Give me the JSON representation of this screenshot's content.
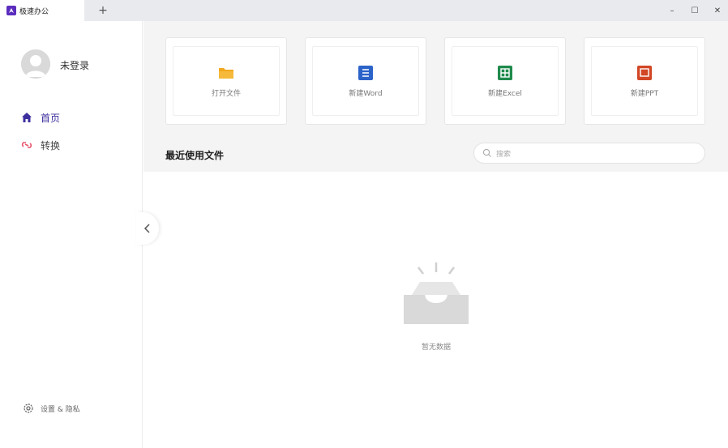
{
  "window": {
    "tab_title": "极速办公",
    "new_tab": "+",
    "minimize": "–",
    "maximize": "☐",
    "close": "✕"
  },
  "sidebar": {
    "username": "未登录",
    "nav": [
      {
        "label": "首页",
        "icon": "home-icon",
        "active": true
      },
      {
        "label": "转换",
        "icon": "convert-icon",
        "active": false
      }
    ],
    "settings_label": "设置 & 隐私"
  },
  "main": {
    "cards": [
      {
        "label": "打开文件",
        "icon": "folder-icon",
        "color": "#f2a81d"
      },
      {
        "label": "新建Word",
        "icon": "word-icon",
        "color": "#2b63c9"
      },
      {
        "label": "新建Excel",
        "icon": "excel-icon",
        "color": "#1f8a4c"
      },
      {
        "label": "新建PPT",
        "icon": "ppt-icon",
        "color": "#d24726"
      }
    ],
    "recent_title": "最近使用文件",
    "search_placeholder": "搜索",
    "empty_text": "暂无数据"
  },
  "colors": {
    "accent": "#3c2f9e",
    "convert_icon": "#e8556b",
    "logo": "#5b2dbe"
  }
}
